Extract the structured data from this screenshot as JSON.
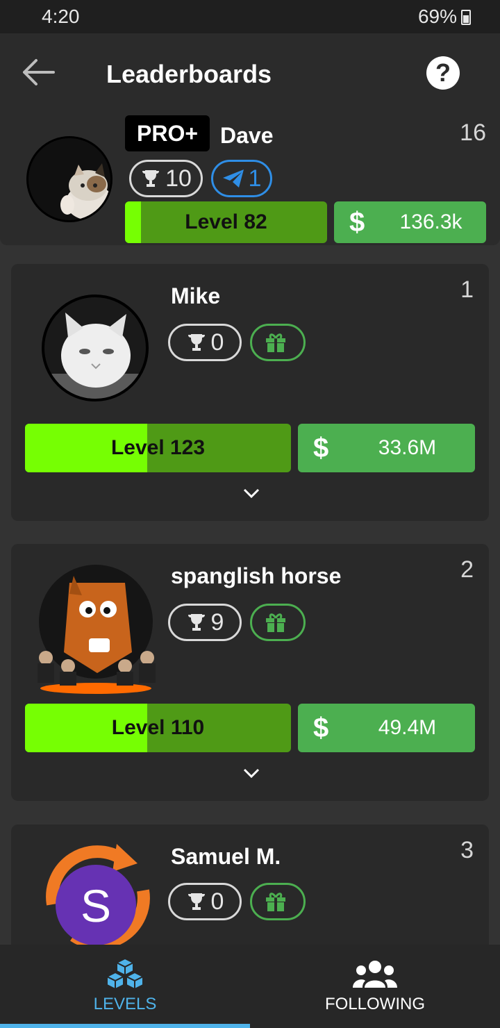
{
  "status_bar": {
    "time": "4:20",
    "battery": "69%"
  },
  "header": {
    "title": "Leaderboards",
    "help_label": "?"
  },
  "me": {
    "badge": "PRO+",
    "name": "Dave",
    "rank": "16",
    "trophies": "10",
    "sent": "1",
    "level_label": "Level 82",
    "level_progress": 0.08,
    "money": "136.3k"
  },
  "entries": [
    {
      "rank": "1",
      "name": "Mike",
      "trophies": "0",
      "level_label": "Level 123",
      "level_progress": 0.46,
      "money": "33.6M"
    },
    {
      "rank": "2",
      "name": "spanglish horse",
      "trophies": "9",
      "level_label": "Level 110",
      "level_progress": 0.46,
      "money": "49.4M"
    },
    {
      "rank": "3",
      "name": "Samuel M.",
      "trophies": "0",
      "avatar_letter": "S"
    }
  ],
  "bottom_nav": {
    "levels": "LEVELS",
    "following": "FOLLOWING"
  },
  "colors": {
    "accent": "#4fb3ea",
    "level_fill": "#76ff03",
    "level_bg": "#4f9a16",
    "money": "#4caf50",
    "plane": "#2f8ee6"
  }
}
